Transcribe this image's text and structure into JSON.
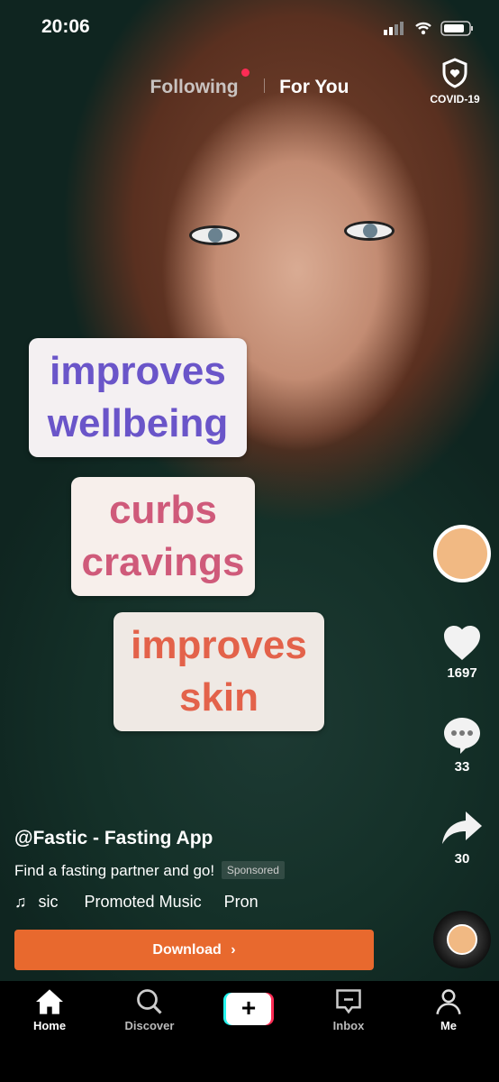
{
  "status_bar": {
    "time": "20:06"
  },
  "top_nav": {
    "following": "Following",
    "for_you": "For You",
    "covid": "COVID-19"
  },
  "overlay_cards": [
    {
      "text": "improves wellbeing",
      "color": "#6a55c9"
    },
    {
      "text": "curbs cravings",
      "color": "#cf5a7a"
    },
    {
      "text": "improves skin",
      "color": "#e3624a"
    }
  ],
  "rail": {
    "likes": "1697",
    "comments": "33",
    "shares": "30"
  },
  "caption": {
    "username": "@Fastic - Fasting App",
    "description": "Find a fasting partner and go!",
    "sponsored": "Sponsored",
    "music_1": "sic",
    "music_2": "Promoted Music",
    "music_3": "Pron"
  },
  "cta": {
    "label": "Download",
    "color": "#e8692e"
  },
  "bottom_nav": {
    "home": "Home",
    "discover": "Discover",
    "inbox": "Inbox",
    "me": "Me"
  }
}
